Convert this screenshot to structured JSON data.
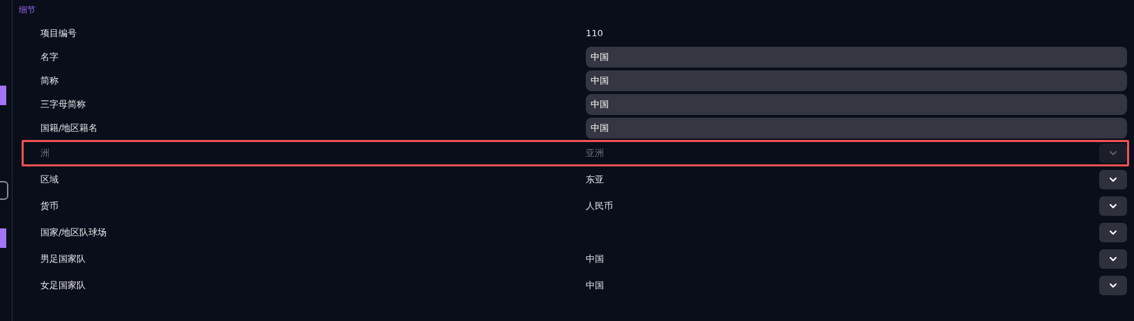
{
  "section": {
    "title": "细节"
  },
  "rows": [
    {
      "label": "项目编号",
      "kind": "text",
      "value": "110",
      "disabled": false,
      "highlighted": false
    },
    {
      "label": "名字",
      "kind": "input",
      "value": "中国",
      "disabled": false,
      "highlighted": false
    },
    {
      "label": "简称",
      "kind": "input",
      "value": "中国",
      "disabled": false,
      "highlighted": false
    },
    {
      "label": "三字母简称",
      "kind": "input",
      "value": "中国",
      "disabled": false,
      "highlighted": false
    },
    {
      "label": "国籍/地区籍名",
      "kind": "input",
      "value": "中国",
      "disabled": false,
      "highlighted": false
    },
    {
      "label": "洲",
      "kind": "select",
      "value": "亚洲",
      "disabled": true,
      "highlighted": true
    },
    {
      "label": "区域",
      "kind": "select",
      "value": "东亚",
      "disabled": false,
      "highlighted": false
    },
    {
      "label": "货币",
      "kind": "select",
      "value": "人民币",
      "disabled": false,
      "highlighted": false
    },
    {
      "label": "国家/地区队球场",
      "kind": "select",
      "disabled": false,
      "highlighted": false
    },
    {
      "label": "男足国家队",
      "kind": "select",
      "value": "中国",
      "disabled": false,
      "highlighted": false
    },
    {
      "label": "女足国家队",
      "kind": "select",
      "value": "中国",
      "disabled": false,
      "highlighted": false
    }
  ]
}
